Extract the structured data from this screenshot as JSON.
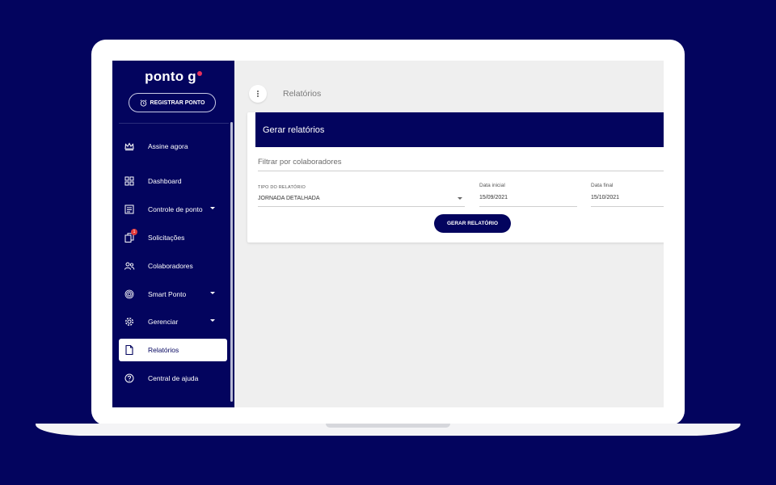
{
  "sidebar": {
    "logo": "ponto g",
    "register_button": "REGISTRAR PONTO",
    "items": [
      {
        "label": "Assine agora",
        "icon": "crown-icon"
      },
      {
        "label": "Dashboard",
        "icon": "dashboard-icon"
      },
      {
        "label": "Controle de ponto",
        "icon": "calendar-icon"
      },
      {
        "label": "Solicitações",
        "icon": "copy-icon",
        "badge": "1"
      },
      {
        "label": "Colaboradores",
        "icon": "people-icon"
      },
      {
        "label": "Smart Ponto",
        "icon": "fingerprint-icon"
      },
      {
        "label": "Gerenciar",
        "icon": "gear-icon"
      },
      {
        "label": "Relatórios",
        "icon": "file-icon",
        "active": true
      },
      {
        "label": "Central de ajuda",
        "icon": "help-icon"
      }
    ]
  },
  "topbar": {
    "title": "Relatórios"
  },
  "card": {
    "header": "Gerar relatórios",
    "filter_placeholder": "Filtrar por colaboradores",
    "report_type_label": "TIPO DO RELATÓRIO",
    "report_type_value": "JORNADA DETALHADA",
    "start_label": "Data inicial",
    "start_value": "15/09/2021",
    "end_label": "Data final",
    "end_value": "15/10/2021",
    "generate_button": "GERAR RELATÓRIO"
  },
  "colors": {
    "brand": "#03045e",
    "accent": "#e8305c",
    "badge": "#e23a3a"
  }
}
